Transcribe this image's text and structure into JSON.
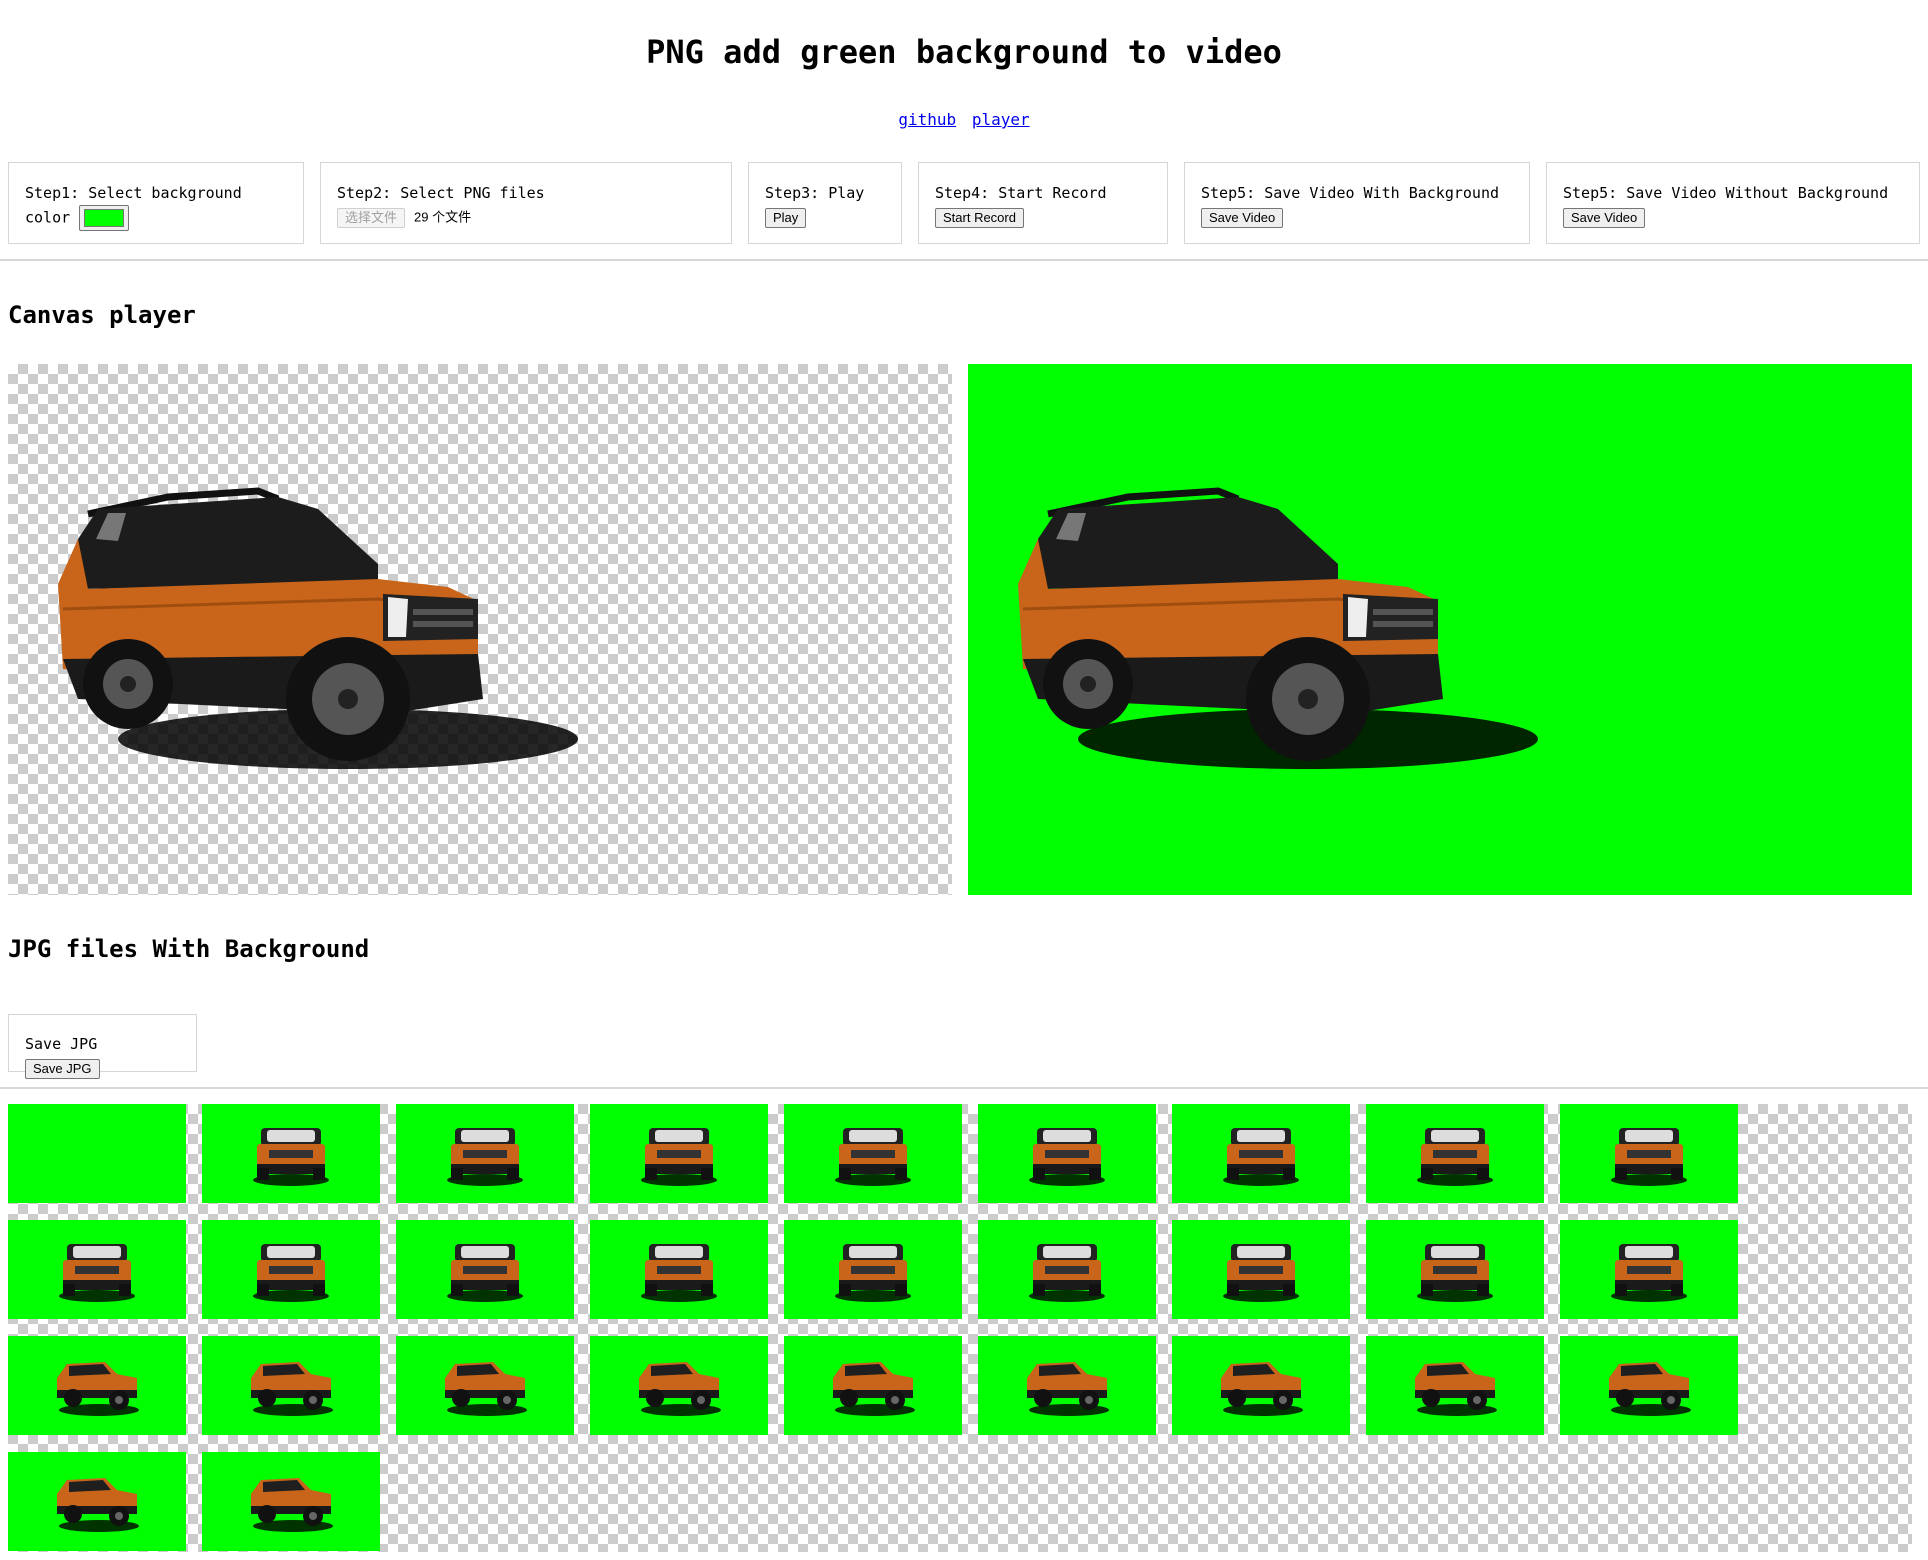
{
  "page": {
    "title": "PNG add green background to video",
    "links": [
      "github",
      "player"
    ]
  },
  "steps": {
    "step1": {
      "label": "Step1: Select background color",
      "color": "#00ff00"
    },
    "step2": {
      "label": "Step2: Select PNG files",
      "file_button": "选择文件",
      "file_count": "29 个文件"
    },
    "step3": {
      "label": "Step3: Play",
      "button": "Play"
    },
    "step4": {
      "label": "Step4: Start Record",
      "button": "Start Record"
    },
    "step5a": {
      "label": "Step5: Save Video With Background",
      "button": "Save Video"
    },
    "step5b": {
      "label": "Step5: Save Video Without Background",
      "button": "Save Video"
    }
  },
  "canvas_section": {
    "heading": "Canvas player",
    "left_background": "transparent-checkerboard",
    "right_background": "#00ff00"
  },
  "jpg_section": {
    "heading": "JPG files With Background",
    "save_label": "Save JPG",
    "save_button": "Save JPG",
    "thumbnail_count": 29,
    "thumbnails_per_row": 9
  },
  "icons": {
    "car": "orange-suv-image"
  },
  "colors": {
    "background": "#00ff00",
    "car_body": "#c8651a",
    "link": "#0000ee"
  }
}
